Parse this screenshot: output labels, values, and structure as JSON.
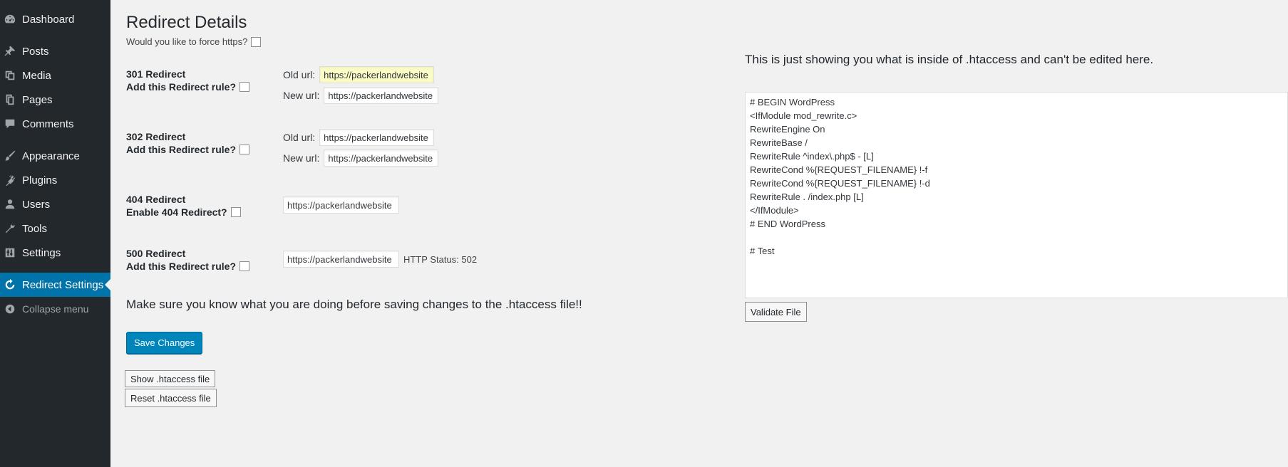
{
  "sidebar": {
    "items": [
      {
        "label": "Dashboard",
        "icon": "dashboard-icon"
      },
      {
        "label": "Posts",
        "icon": "pin-icon"
      },
      {
        "label": "Media",
        "icon": "media-icon"
      },
      {
        "label": "Pages",
        "icon": "pages-icon"
      },
      {
        "label": "Comments",
        "icon": "comment-icon"
      },
      {
        "label": "Appearance",
        "icon": "brush-icon"
      },
      {
        "label": "Plugins",
        "icon": "plug-icon"
      },
      {
        "label": "Users",
        "icon": "user-icon"
      },
      {
        "label": "Tools",
        "icon": "wrench-icon"
      },
      {
        "label": "Settings",
        "icon": "sliders-icon"
      },
      {
        "label": "Redirect Settings",
        "icon": "refresh-icon"
      },
      {
        "label": "Collapse menu",
        "icon": "collapse-icon"
      }
    ]
  },
  "page": {
    "title": "Redirect Details",
    "force_https_label": "Would you like to force https?"
  },
  "redirects": {
    "r301": {
      "title": "301 Redirect",
      "rule_label": "Add this Redirect rule?",
      "old_label": "Old url:",
      "old_value": "https://packerlandwebsite",
      "new_label": "New url:",
      "new_value": "https://packerlandwebsite"
    },
    "r302": {
      "title": "302 Redirect",
      "rule_label": "Add this Redirect rule?",
      "old_label": "Old url:",
      "old_value": "https://packerlandwebsite",
      "new_label": "New url:",
      "new_value": "https://packerlandwebsite"
    },
    "r404": {
      "title": "404 Redirect",
      "rule_label": "Enable 404 Redirect?",
      "value": "https://packerlandwebsite"
    },
    "r500": {
      "title": "500 Redirect",
      "rule_label": "Add this Redirect rule?",
      "value": "https://packerlandwebsite",
      "status_text": "HTTP Status: 502"
    }
  },
  "warning": "Make sure you know what you are doing before saving changes to the .htaccess file!!",
  "buttons": {
    "save": "Save Changes",
    "show": "Show .htaccess file",
    "reset": "Reset .htaccess file",
    "validate": "Validate File"
  },
  "htaccess": {
    "info": "This is just showing you what is inside of .htaccess and can't be edited here.",
    "lines": [
      "# BEGIN WordPress",
      "<IfModule mod_rewrite.c>",
      "RewriteEngine On",
      "RewriteBase /",
      "RewriteRule ^index\\.php$ - [L]",
      "RewriteCond %{REQUEST_FILENAME} !-f",
      "RewriteCond %{REQUEST_FILENAME} !-d",
      "RewriteRule . /index.php [L]",
      "</IfModule>",
      "# END WordPress",
      "",
      "# Test"
    ]
  }
}
